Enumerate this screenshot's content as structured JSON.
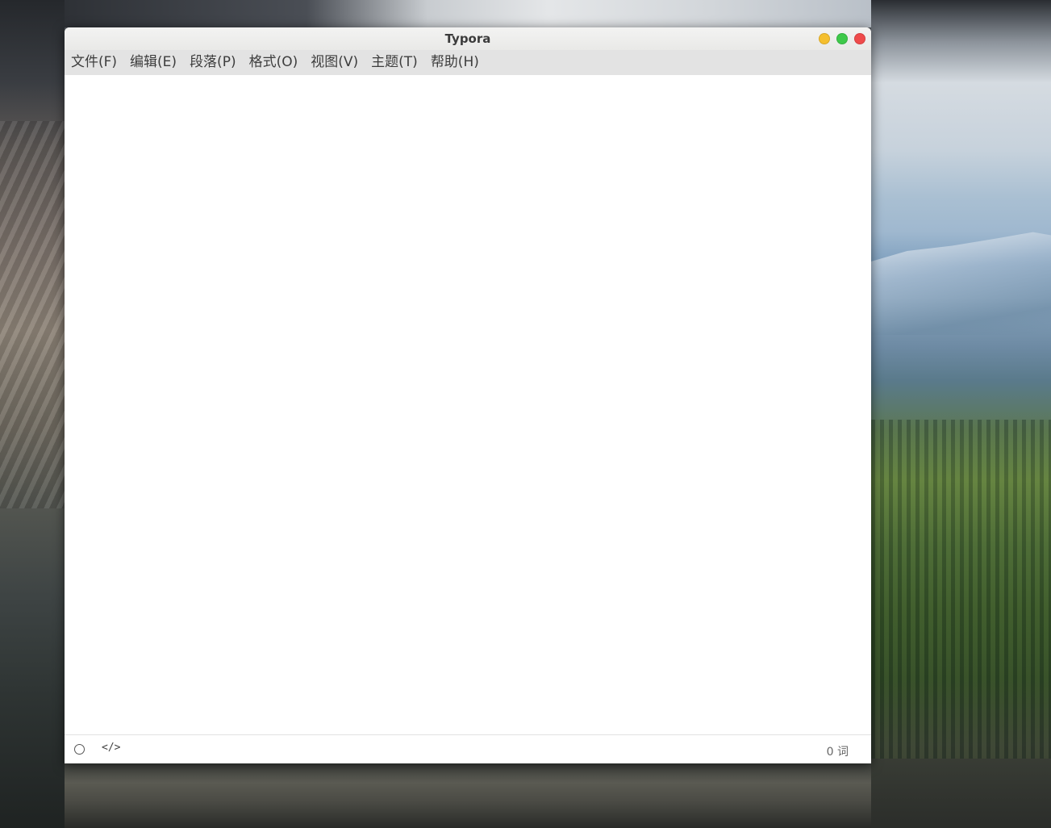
{
  "window": {
    "title": "Typora"
  },
  "controls": {
    "minimize_color": "#f5bf2e",
    "maximize_color": "#3ec94a",
    "close_color": "#ef4b4b"
  },
  "menubar": {
    "items": [
      {
        "label": "文件(F)"
      },
      {
        "label": "编辑(E)"
      },
      {
        "label": "段落(P)"
      },
      {
        "label": "格式(O)"
      },
      {
        "label": "视图(V)"
      },
      {
        "label": "主题(T)"
      },
      {
        "label": "帮助(H)"
      }
    ]
  },
  "statusbar": {
    "outline_icon": "circle-icon",
    "source_code_icon": "</>",
    "word_count": "0 词"
  }
}
